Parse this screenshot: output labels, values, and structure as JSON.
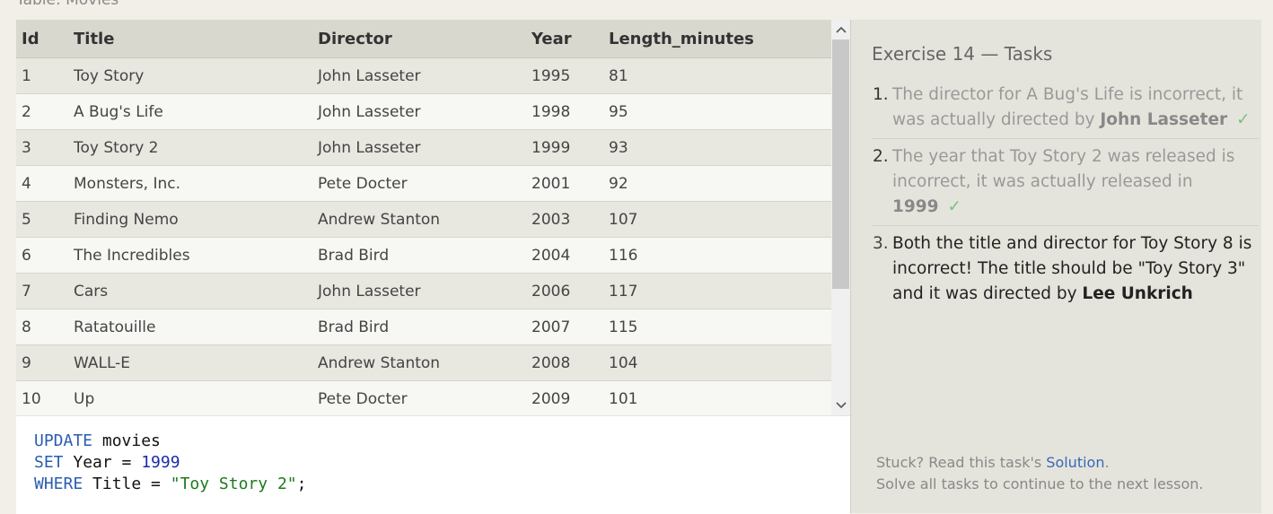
{
  "caption": "Table: Movies",
  "table": {
    "headers": [
      "Id",
      "Title",
      "Director",
      "Year",
      "Length_minutes"
    ],
    "rows": [
      [
        "1",
        "Toy Story",
        "John Lasseter",
        "1995",
        "81"
      ],
      [
        "2",
        "A Bug's Life",
        "John Lasseter",
        "1998",
        "95"
      ],
      [
        "3",
        "Toy Story 2",
        "John Lasseter",
        "1999",
        "93"
      ],
      [
        "4",
        "Monsters, Inc.",
        "Pete Docter",
        "2001",
        "92"
      ],
      [
        "5",
        "Finding Nemo",
        "Andrew Stanton",
        "2003",
        "107"
      ],
      [
        "6",
        "The Incredibles",
        "Brad Bird",
        "2004",
        "116"
      ],
      [
        "7",
        "Cars",
        "John Lasseter",
        "2006",
        "117"
      ],
      [
        "8",
        "Ratatouille",
        "Brad Bird",
        "2007",
        "115"
      ],
      [
        "9",
        "WALL-E",
        "Andrew Stanton",
        "2008",
        "104"
      ],
      [
        "10",
        "Up",
        "Pete Docter",
        "2009",
        "101"
      ]
    ]
  },
  "editor": {
    "line1_kw": "UPDATE",
    "line1_rest": " movies",
    "line2_kw": "SET",
    "line2_rest": " Year = ",
    "line2_num": "1999",
    "line3_kw": "WHERE",
    "line3_rest": " Title = ",
    "line3_str": "\"Toy Story 2\"",
    "line3_end": ";"
  },
  "panel": {
    "title": "Exercise 14 — Tasks",
    "tasks": [
      {
        "num": "1.",
        "text": "The director for A Bug's Life is incorrect, it was actually directed by ",
        "bold": "John Lasseter",
        "tail": "",
        "check": "✓"
      },
      {
        "num": "2.",
        "text": "The year that Toy Story 2 was released is incorrect, it was actually released in ",
        "bold": "1999",
        "tail": "",
        "check": "✓"
      },
      {
        "num": "3.",
        "text": "Both the title and director for Toy Story 8 is incorrect! The title should be \"Toy Story 3\" and it was directed by ",
        "bold": "Lee Unkrich",
        "tail": ""
      }
    ],
    "footer_prefix": "Stuck? Read this task's ",
    "footer_link": "Solution",
    "footer_suffix": ".",
    "footer_line2": "Solve all tasks to continue to the next lesson."
  }
}
